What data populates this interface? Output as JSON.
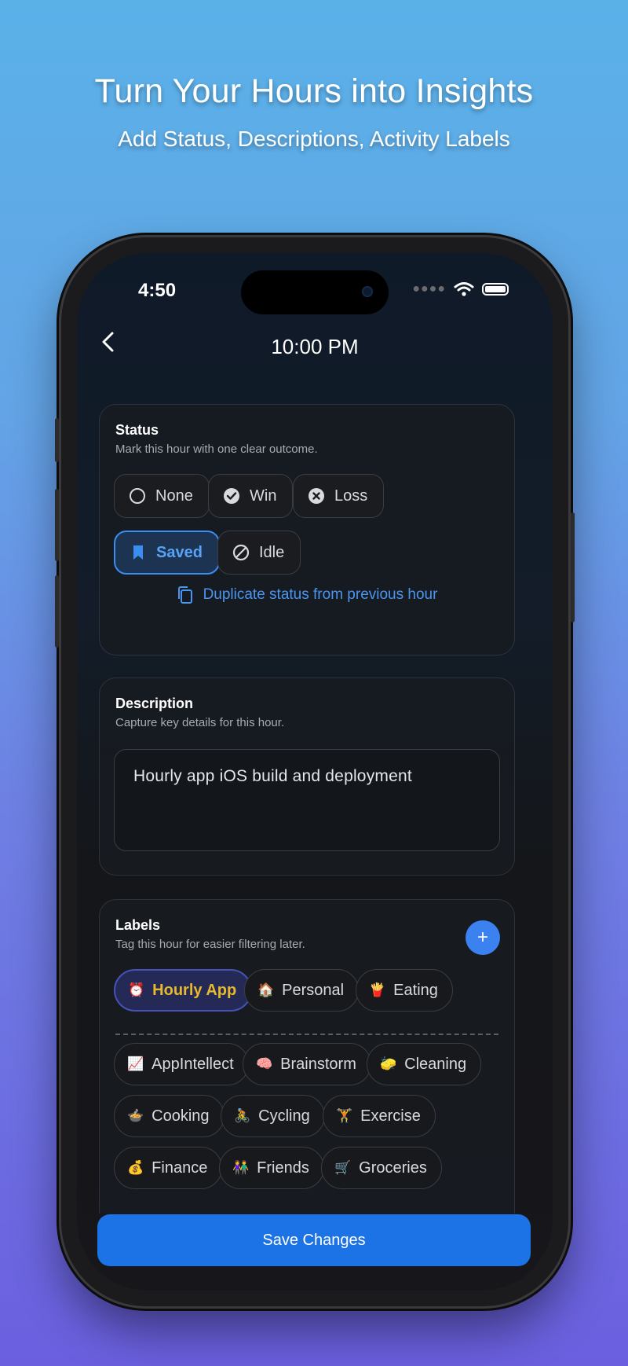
{
  "hero": {
    "title": "Turn Your Hours into Insights",
    "subtitle": "Add Status, Descriptions, Activity Labels"
  },
  "status_bar": {
    "time": "4:50"
  },
  "nav": {
    "title": "10:00 PM",
    "back_icon": "chevron-left-icon"
  },
  "status_card": {
    "title": "Status",
    "subtitle": "Mark this hour with one clear outcome.",
    "options": [
      {
        "label": "None",
        "icon": "circle-outline-icon",
        "selected": false
      },
      {
        "label": "Win",
        "icon": "check-circle-icon",
        "selected": false
      },
      {
        "label": "Loss",
        "icon": "x-circle-icon",
        "selected": false
      },
      {
        "label": "Saved",
        "icon": "bookmark-icon",
        "selected": true
      },
      {
        "label": "Idle",
        "icon": "slash-circle-icon",
        "selected": false
      }
    ],
    "duplicate_label": "Duplicate status from previous hour"
  },
  "description_card": {
    "title": "Description",
    "subtitle": "Capture key details for this hour.",
    "value": "Hourly app iOS build and deployment"
  },
  "labels_card": {
    "title": "Labels",
    "subtitle": "Tag this hour for easier filtering later.",
    "add_label": "+",
    "selected": [
      {
        "emoji": "⏰",
        "label": "Hourly App",
        "active": true
      },
      {
        "emoji": "🏠",
        "label": "Personal",
        "active": false
      },
      {
        "emoji": "🍟",
        "label": "Eating",
        "active": false
      }
    ],
    "available": [
      {
        "emoji": "📈",
        "label": "AppIntellect"
      },
      {
        "emoji": "🧠",
        "label": "Brainstorm"
      },
      {
        "emoji": "🧽",
        "label": "Cleaning"
      },
      {
        "emoji": "🍲",
        "label": "Cooking"
      },
      {
        "emoji": "🚴",
        "label": "Cycling"
      },
      {
        "emoji": "🏋",
        "label": "Exercise"
      },
      {
        "emoji": "💰",
        "label": "Finance"
      },
      {
        "emoji": "👫",
        "label": "Friends"
      },
      {
        "emoji": "🛒",
        "label": "Groceries"
      }
    ]
  },
  "save_button": {
    "label": "Save Changes"
  },
  "colors": {
    "accent": "#1b73e6",
    "selected_status": "#3b8ef0",
    "active_label_text": "#e8b92e"
  }
}
